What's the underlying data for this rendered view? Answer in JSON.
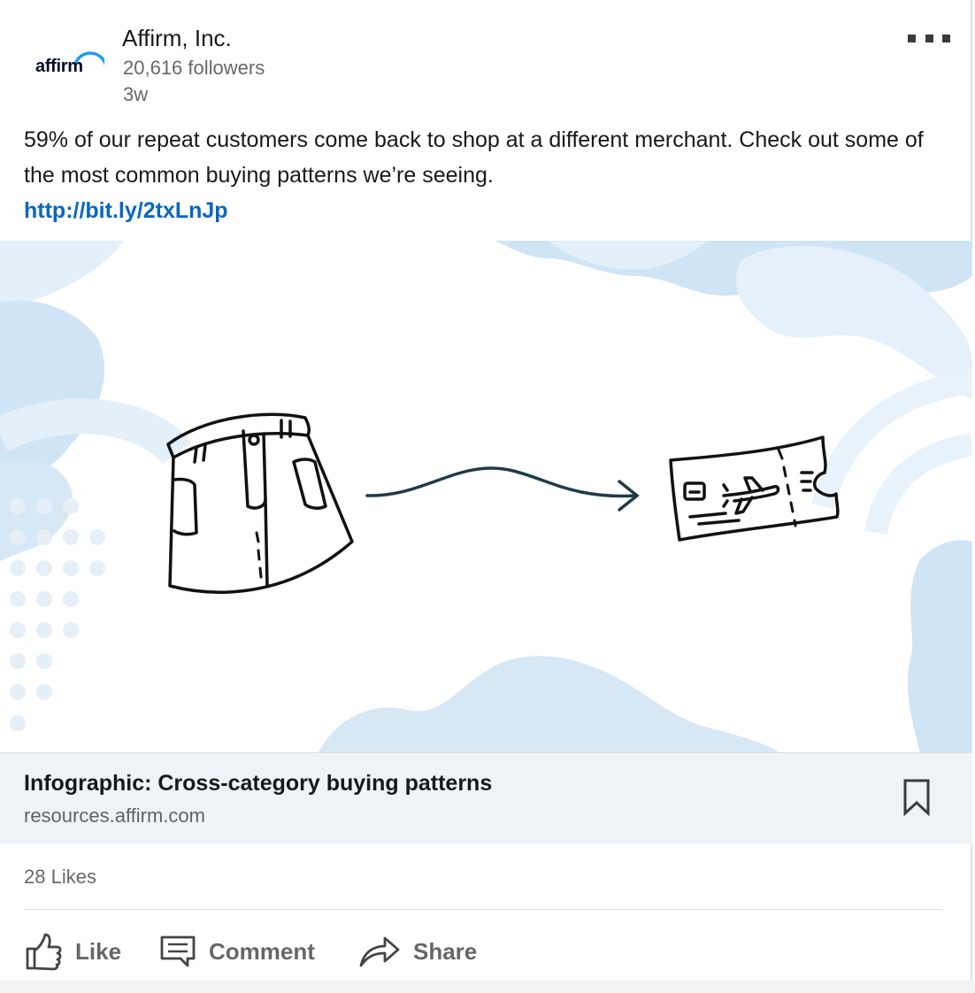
{
  "post": {
    "company": {
      "name": "Affirm, Inc.",
      "logo_text": "affirm",
      "followers": "20,616 followers",
      "age": "3w"
    },
    "text": "59% of our repeat customers come back to shop at a different merchant. Check out some of the most common buying patterns we’re seeing.",
    "link": "http://bit.ly/2txLnJp",
    "image": {
      "subject": "skirt-to-plane-ticket illustration"
    },
    "link_preview": {
      "title": "Infographic: Cross-category buying patterns",
      "domain": "resources.affirm.com"
    },
    "likes": "28 Likes",
    "actions": {
      "like": "Like",
      "comment": "Comment",
      "share": "Share"
    }
  },
  "colors": {
    "link": "#0a66c2",
    "preview_bg": "#eef3f8",
    "accent_logo": "#1a9ef0",
    "illustration_blue": "#cfe4f4"
  },
  "icons": [
    "more-icon",
    "bookmark-icon",
    "like-icon",
    "comment-icon",
    "share-icon"
  ]
}
